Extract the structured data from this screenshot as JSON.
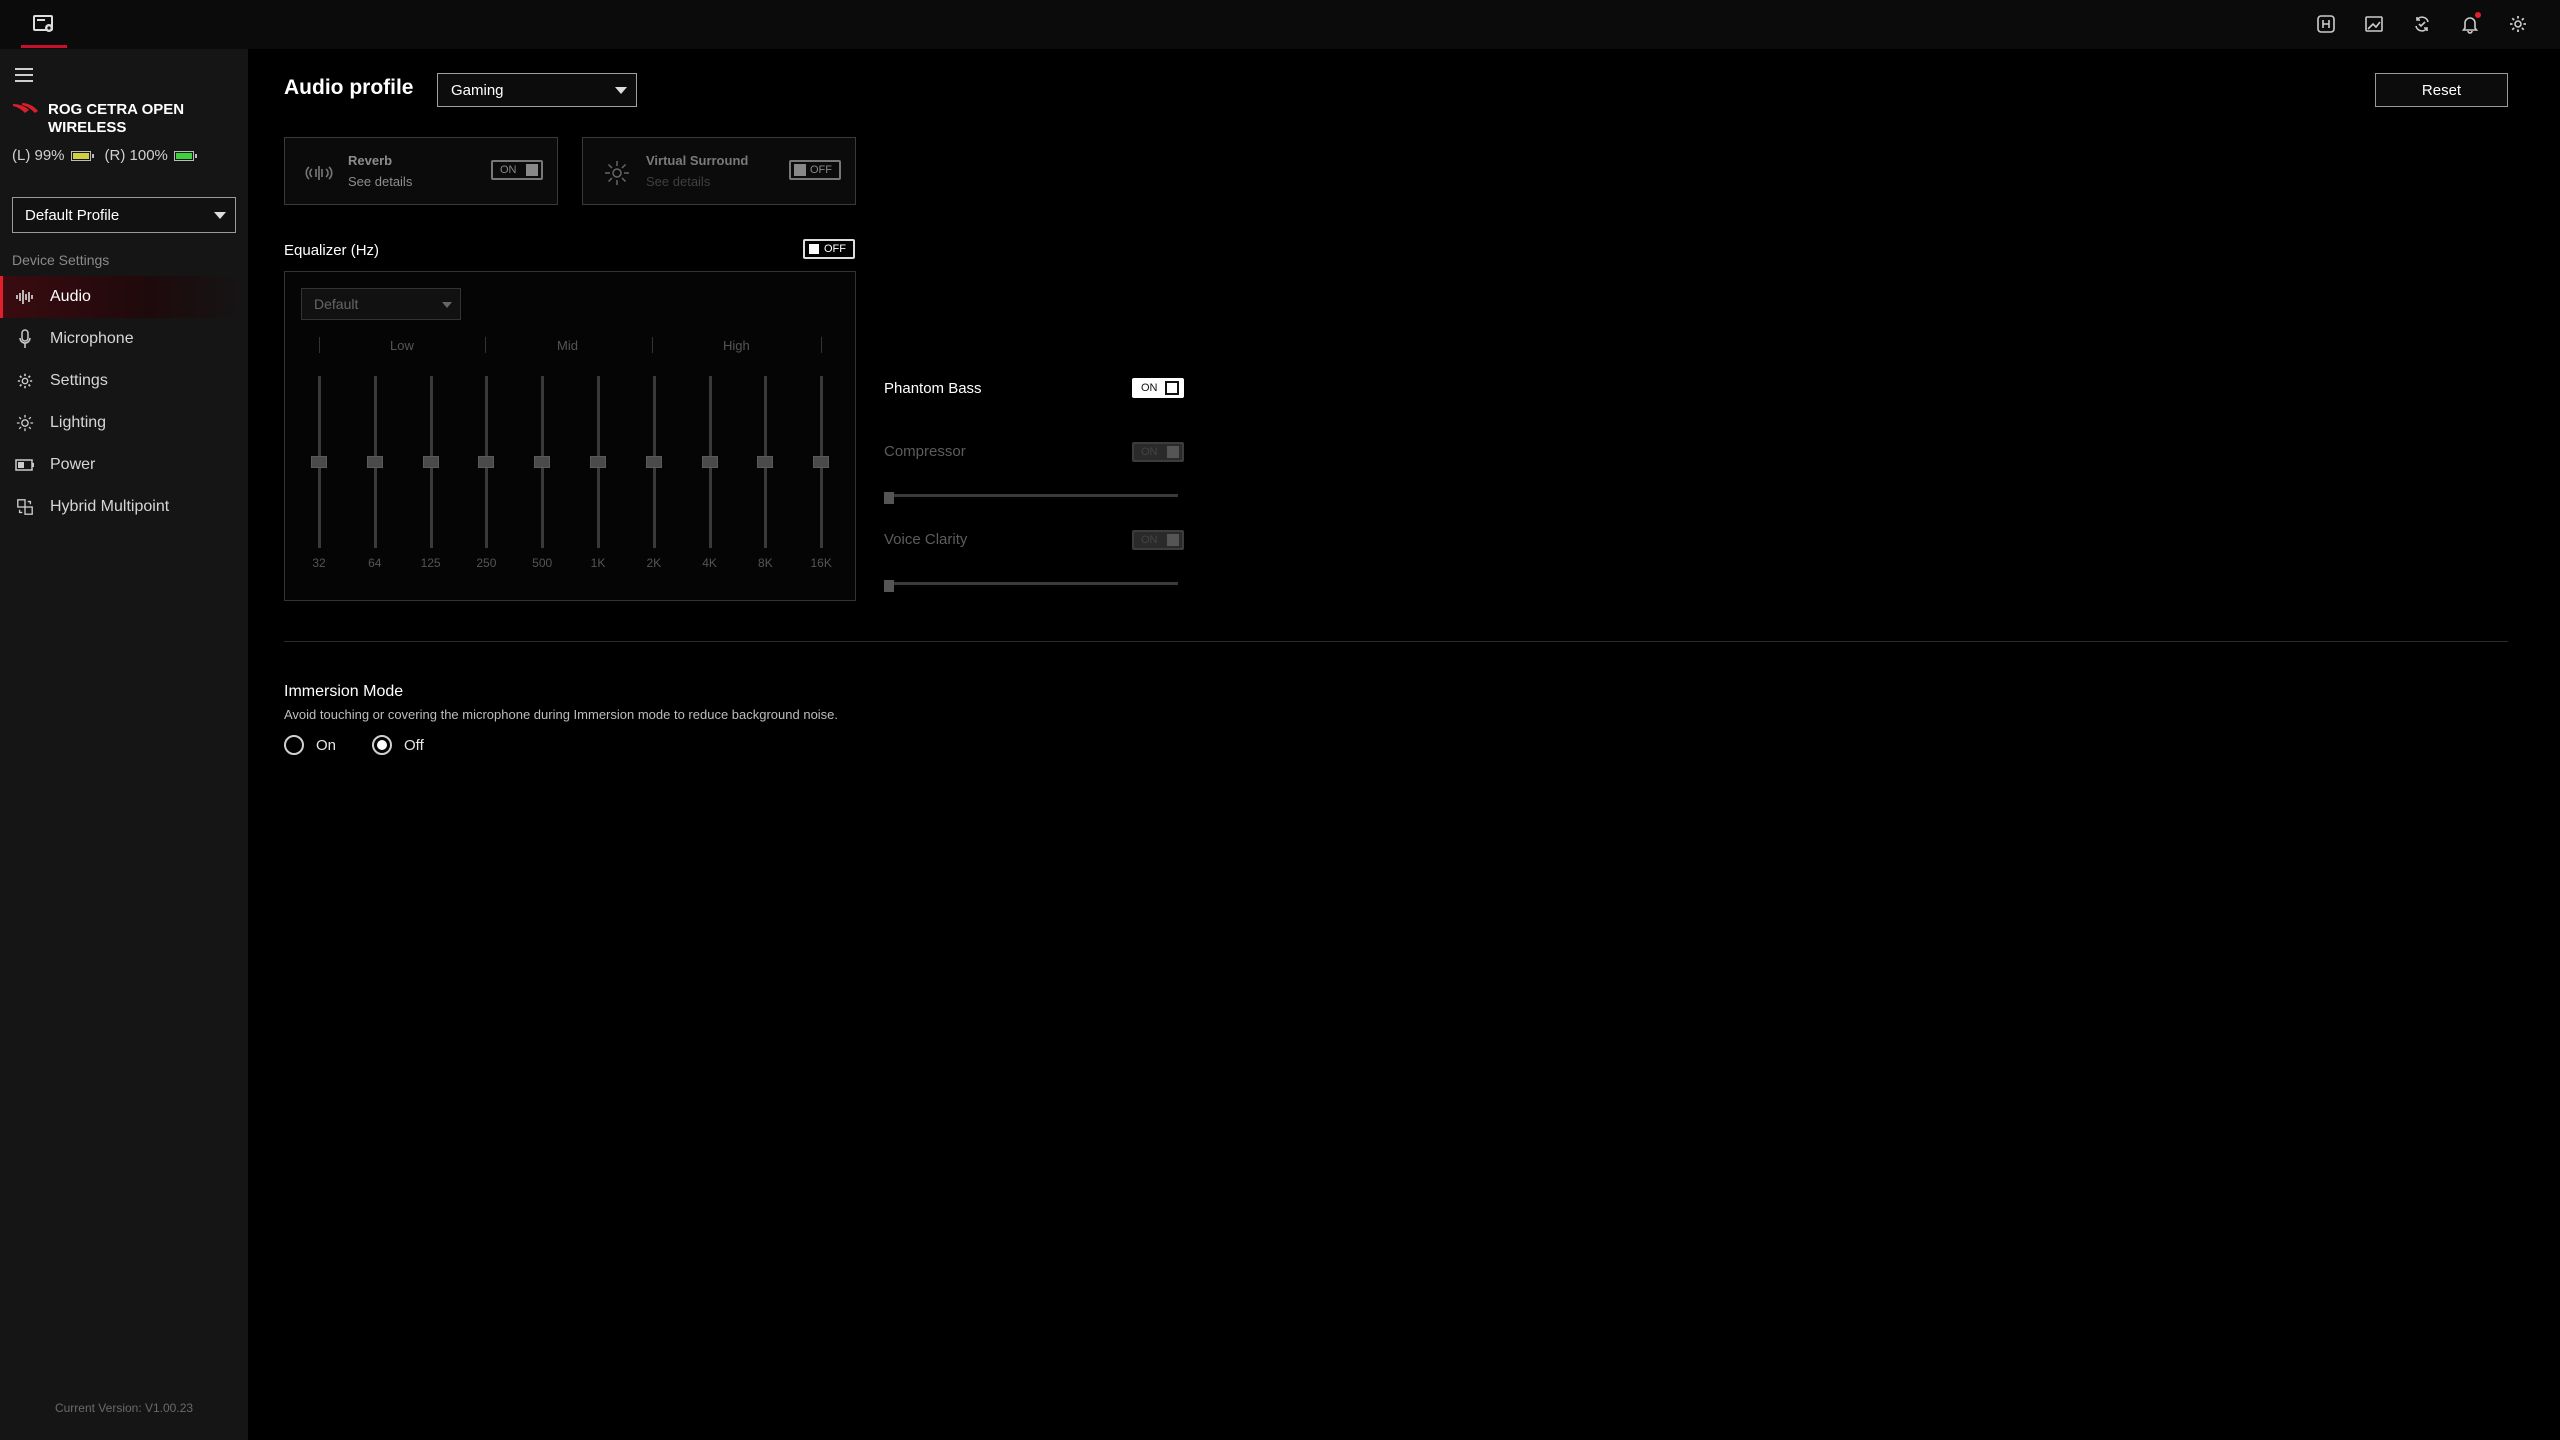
{
  "topbar": {
    "app_icon": "armoury-crate-icon",
    "icons": [
      "keyboard-macro-icon",
      "image-edit-icon",
      "sync-icon",
      "notification-bell-icon",
      "settings-gear-icon"
    ]
  },
  "sidebar": {
    "device_name": "ROG CETRA OPEN WIRELESS",
    "battery_left": "(L) 99%",
    "battery_right": "(R) 100%",
    "battery_left_level": 0.99,
    "battery_right_level": 1.0,
    "profile_value": "Default Profile",
    "section_label": "Device Settings",
    "items": [
      {
        "label": "Audio",
        "icon": "audio-wave-icon",
        "active": true
      },
      {
        "label": "Microphone",
        "icon": "microphone-icon",
        "active": false
      },
      {
        "label": "Settings",
        "icon": "gear-icon",
        "active": false
      },
      {
        "label": "Lighting",
        "icon": "lighting-icon",
        "active": false
      },
      {
        "label": "Power",
        "icon": "battery-icon",
        "active": false
      },
      {
        "label": "Hybrid Multipoint",
        "icon": "multipoint-icon",
        "active": false
      }
    ],
    "version": "Current Version: V1.00.23"
  },
  "main": {
    "title": "Audio profile",
    "audio_profile_value": "Gaming",
    "reset_label": "Reset",
    "reverb": {
      "name": "Reverb",
      "sub": "See details",
      "toggle": "ON"
    },
    "virtual_surround": {
      "name": "Virtual Surround",
      "sub": "See details",
      "toggle": "OFF"
    },
    "equalizer": {
      "title": "Equalizer (Hz)",
      "toggle": "OFF",
      "preset": "Default",
      "bands": [
        "Low",
        "Mid",
        "High"
      ],
      "frequencies": [
        "32",
        "64",
        "125",
        "250",
        "500",
        "1K",
        "2K",
        "4K",
        "8K",
        "16K"
      ],
      "levels": [
        0,
        0,
        0,
        0,
        0,
        0,
        0,
        0,
        0,
        0
      ]
    },
    "phantom_bass": {
      "label": "Phantom Bass",
      "toggle": "ON"
    },
    "compressor": {
      "label": "Compressor",
      "toggle": "ON",
      "level": 0
    },
    "voice_clarity": {
      "label": "Voice Clarity",
      "toggle": "ON",
      "level": 0
    },
    "immersion": {
      "title": "Immersion Mode",
      "description": "Avoid touching or covering the microphone during Immersion mode to reduce background noise.",
      "on_label": "On",
      "off_label": "Off",
      "selected": "Off"
    }
  },
  "colors": {
    "accent": "#e0202a",
    "background": "#000000",
    "sidebar": "#151515"
  }
}
